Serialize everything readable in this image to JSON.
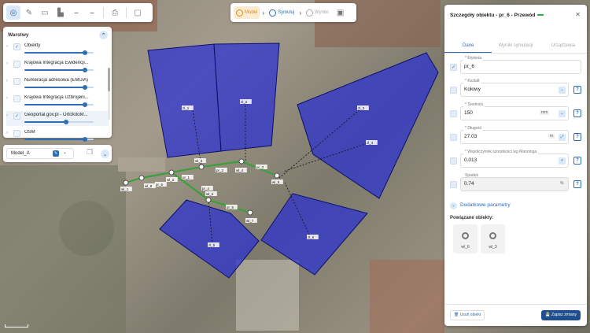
{
  "toolbar": {
    "left_icons": [
      "target-icon",
      "pencil-icon",
      "ruler-icon",
      "chart-icon",
      "measure-icon",
      "measure2-icon",
      "print-icon",
      "frame-icon"
    ],
    "steps": [
      {
        "label": "Model",
        "state": "active"
      },
      {
        "label": "Symuluj",
        "state": "enabled"
      },
      {
        "label": "Wyniki",
        "state": "disabled"
      }
    ]
  },
  "layers": {
    "title": "Warstwy",
    "items": [
      {
        "label": "Obiekty",
        "checked": true,
        "opacity": 0.88
      },
      {
        "label": "Krajowa Integracja Ewidencji...",
        "checked": false,
        "opacity": 0.88
      },
      {
        "label": "Numeracja adresowa (EMUiA)",
        "checked": false,
        "opacity": 0.88
      },
      {
        "label": "Krajowa Integracja Uzbrojeni...",
        "checked": false,
        "opacity": 0.88
      },
      {
        "label": "Geoportal.gov.pl - OrtofotoM...",
        "checked": true,
        "opacity": 0.6
      },
      {
        "label": "OSM",
        "checked": false,
        "opacity": 0.88
      }
    ]
  },
  "model": {
    "name": "Model_A"
  },
  "map": {
    "catchment_labels": [
      "zl_1",
      "zl_2",
      "zl_3",
      "zl_4",
      "zl_5",
      "zl_6"
    ],
    "node_labels": [
      "wl_1",
      "wl_2",
      "wl_3",
      "wl_4",
      "wl_5",
      "wl_6",
      "wl_7",
      "wl_8"
    ],
    "pipe_labels": [
      "pr_1",
      "pr_2",
      "pr_3",
      "pr_4",
      "pr_5",
      "pr_6"
    ],
    "colors": {
      "catchment_fill": "#2a2fd1",
      "catchment_stroke": "#0c0f6b",
      "pipe": "#3aa03a"
    }
  },
  "panel": {
    "title": "Szczegóły obiektu - pr_6 - Przewód",
    "tabs": [
      "Dane",
      "Wyniki symulacji",
      "Urządzenia"
    ],
    "active_tab": "Dane",
    "fields": [
      {
        "label": "* Etykieta",
        "value": "pr_6",
        "checked": true
      },
      {
        "label": "* Kształt",
        "value": "Kołowy",
        "type": "select"
      },
      {
        "label": "* Średnica",
        "value": "150",
        "unit": "mm",
        "type": "select"
      },
      {
        "label": "* Długość",
        "value": "27.03",
        "unit": "m"
      },
      {
        "label": "* Współczynnik szorstkości wg Manninga",
        "value": "0.013"
      },
      {
        "label": "Spadek",
        "value": "0.74",
        "unit": "%",
        "disabled": true
      }
    ],
    "advanced_label": "Dodatkowe parametry",
    "related_title": "Powiązane obiekty:",
    "related": [
      "wl_6",
      "wl_3"
    ],
    "delete_label": "Usuń obiekt",
    "save_label": "Zapisz zmiany"
  }
}
